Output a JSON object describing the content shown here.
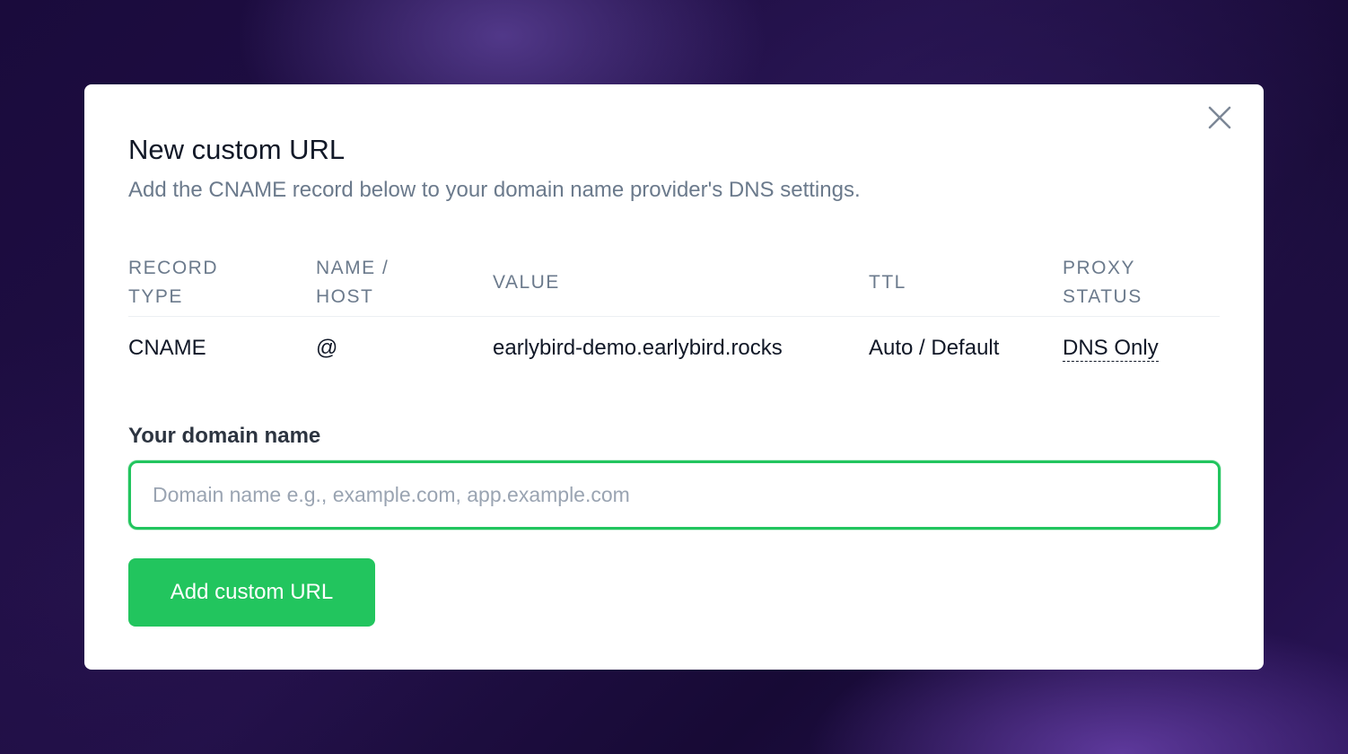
{
  "modal": {
    "title": "New custom URL",
    "subtitle": "Add the CNAME record below to your domain name provider's DNS settings.",
    "close_icon": "close-icon"
  },
  "dns_table": {
    "headers": [
      "RECORD TYPE",
      "NAME / HOST",
      "VALUE",
      "TTL",
      "PROXY STATUS"
    ],
    "rows": [
      [
        "CNAME",
        "@",
        "earlybird-demo.earlybird.rocks",
        "Auto / Default",
        "DNS Only"
      ]
    ]
  },
  "domain_field": {
    "label": "Your domain name",
    "value": "",
    "placeholder": "Domain name e.g., example.com, app.example.com"
  },
  "submit_button": {
    "label": "Add custom URL"
  },
  "colors": {
    "accent": "#22c55e",
    "text": "#111827",
    "muted": "#6b7a8c",
    "backdrop": "#170a35"
  }
}
